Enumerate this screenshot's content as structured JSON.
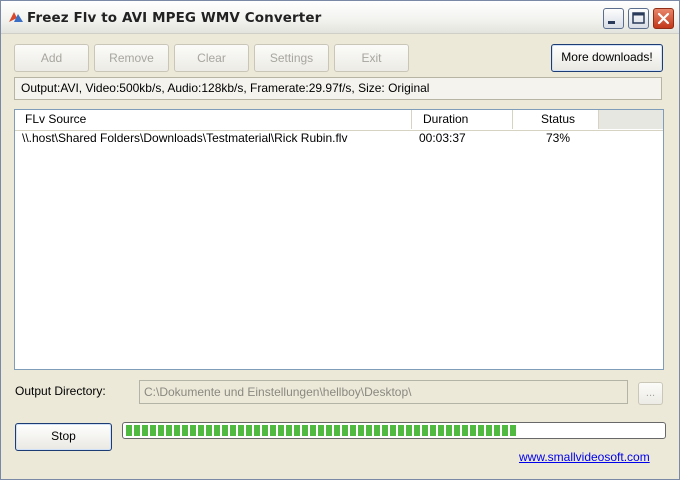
{
  "window": {
    "title": "Freez Flv to AVI MPEG WMV Converter",
    "icon": "app-icon",
    "controls": [
      "minimize-icon",
      "maximize-icon",
      "close-icon"
    ]
  },
  "toolbar": {
    "add_label": "Add",
    "remove_label": "Remove",
    "clear_label": "Clear",
    "settings_label": "Settings",
    "exit_label": "Exit",
    "more_downloads_label": "More downloads!"
  },
  "output_info": "Output:AVI, Video:500kb/s, Audio:128kb/s, Framerate:29.97f/s, Size: Original",
  "file_list": {
    "columns": [
      "FLv Source",
      "Duration",
      "Status"
    ],
    "rows": [
      {
        "source": "\\\\.host\\Shared Folders\\Downloads\\Testmaterial\\Rick Rubin.flv",
        "duration": "00:03:37",
        "status": "73%"
      }
    ]
  },
  "output_directory": {
    "label": "Output Directory:",
    "value": "C:\\Dokumente und Einstellungen\\hellboy\\Desktop\\",
    "browse_label": "..."
  },
  "stop_label": "Stop",
  "progress": 0.73,
  "website_link": "www.smallvideosoft.com",
  "colors": {
    "progress_green": "#4fba3f",
    "link_blue": "#0000ee",
    "window_face": "#ece9d8"
  }
}
